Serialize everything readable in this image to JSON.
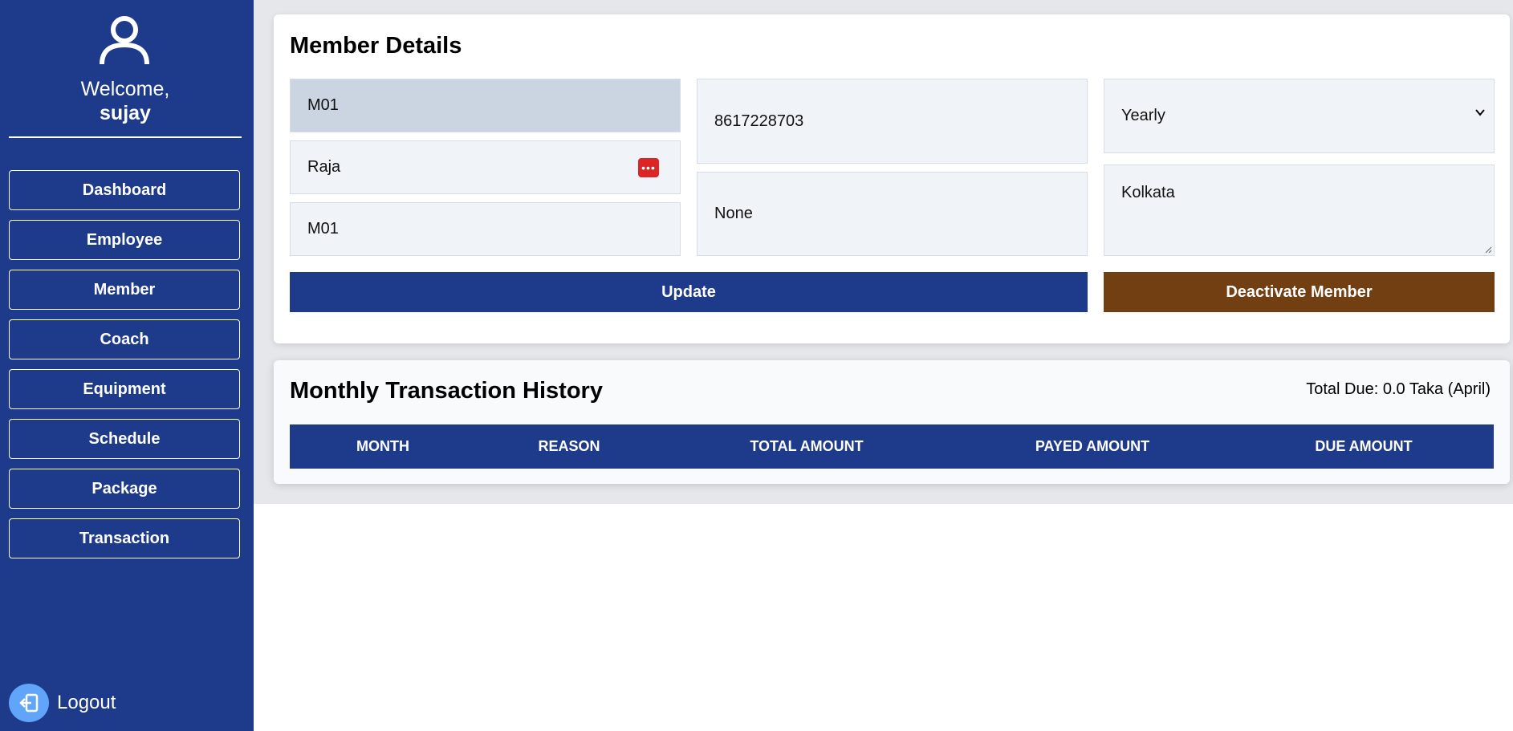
{
  "sidebar": {
    "welcome_text": "Welcome,",
    "username": "sujay",
    "nav": [
      {
        "label": "Dashboard"
      },
      {
        "label": "Employee"
      },
      {
        "label": "Member"
      },
      {
        "label": "Coach"
      },
      {
        "label": "Equipment"
      },
      {
        "label": "Schedule"
      },
      {
        "label": "Package"
      },
      {
        "label": "Transaction"
      }
    ],
    "logout_label": "Logout"
  },
  "member_details": {
    "title": "Member Details",
    "member_id": "M01",
    "name": "Raja",
    "password": "M01",
    "phone": "8617228703",
    "extra": "None",
    "package": "Yearly",
    "address": "Kolkata",
    "update_label": "Update",
    "deactivate_label": "Deactivate Member"
  },
  "transactions": {
    "title": "Monthly Transaction History",
    "total_due": "Total Due: 0.0 Taka (April)",
    "columns": [
      "MONTH",
      "REASON",
      "TOTAL AMOUNT",
      "PAYED AMOUNT",
      "DUE AMOUNT"
    ]
  },
  "colors": {
    "sidebar": "#1e3a8a",
    "primary_button": "#1e3a8a",
    "danger_button": "#713f12",
    "logout_icon_bg": "#60a5fa"
  }
}
